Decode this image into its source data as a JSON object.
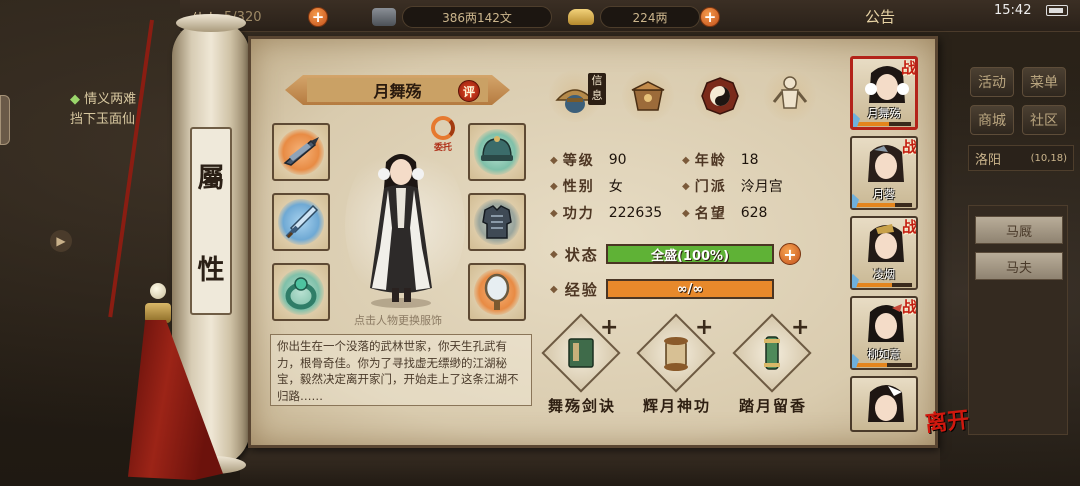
{
  "topbar": {
    "stamina_label": "体力",
    "stamina_value": "5/320",
    "silver_value": "386两142文",
    "gold_value": "224两",
    "announce_label": "公告",
    "clock": "15:42"
  },
  "left_quest": {
    "title": "情义两难",
    "desc": "挡下玉面仙"
  },
  "right_menu": {
    "activity": "活动",
    "menu": "菜单",
    "shop": "商城",
    "community": "社区",
    "location_name": "洛阳",
    "location_coords": "(10,18)",
    "stable": "马厩",
    "groom": "马夫"
  },
  "scroll": {
    "label_top": "屬",
    "label_bottom": "性"
  },
  "character": {
    "name": "月舞殇",
    "rate_label": "评",
    "entrust_label": "委托",
    "tap_hint": "点击人物更换服饰",
    "bio": "你出生在一个没落的武林世家，你天生孔武有力，根骨奇佳。你为了寻找虚无缥缈的江湖秘宝，毅然决定离开家门，开始走上了这条江湖不归路……",
    "sect_tag": "信息"
  },
  "stats": {
    "level_label": "等级",
    "level_value": "90",
    "age_label": "年龄",
    "age_value": "18",
    "gender_label": "性别",
    "gender_value": "女",
    "sect_label": "门派",
    "sect_value": "泠月宫",
    "power_label": "功力",
    "power_value": "222635",
    "fame_label": "名望",
    "fame_value": "628"
  },
  "status_bar": {
    "label": "状态",
    "text": "全盛(100%)",
    "fill": 1.0,
    "color": "#5fb236"
  },
  "exp_bar": {
    "label": "经验",
    "text": "∞/∞",
    "fill": 1.0,
    "color": "#e8892b"
  },
  "skills": [
    {
      "name": "舞殇剑诀",
      "plus": "+"
    },
    {
      "name": "辉月神功",
      "plus": "+"
    },
    {
      "name": "踏月留香",
      "plus": "+"
    }
  ],
  "roster": [
    {
      "name": "月舞殇",
      "badge": "战"
    },
    {
      "name": "月蓉",
      "badge": "战"
    },
    {
      "name": "凌烟",
      "badge": "战"
    },
    {
      "name": "柳如意",
      "badge": "战"
    },
    {
      "name": "",
      "badge": ""
    }
  ],
  "leave_label": "离开",
  "colors": {
    "accent": "#c41e12",
    "parchment": "#dccfb3",
    "status_green": "#5fb236",
    "exp_orange": "#e8892b"
  }
}
